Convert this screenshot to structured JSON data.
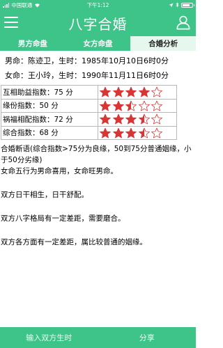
{
  "status_bar": {
    "carrier": "中国联通",
    "time": "下午1:12",
    "battery_level": 0.8
  },
  "navbar": {
    "title": "八字合婚"
  },
  "tabs": [
    {
      "label": "男方命盘",
      "active": false
    },
    {
      "label": "女方命盘",
      "active": false
    },
    {
      "label": "合婚分析",
      "active": true
    }
  ],
  "info": {
    "male": {
      "label": "男命：",
      "name": "陈迹卫，",
      "birth_label": "生时：",
      "birth": "1985年10月10日6时0分"
    },
    "female": {
      "label": "女命：",
      "name": "王小玲，",
      "birth_label": "生时：",
      "birth": "1990年11月11日6时0分"
    }
  },
  "scores": [
    {
      "label": "互相助益指数：75 分",
      "stars": 4
    },
    {
      "label": "缘份指数：50 分",
      "stars": 2.5
    },
    {
      "label": "祸福相配指数：72 分",
      "stars": 3.5
    },
    {
      "label": "综合指数：68 分",
      "stars": 3.5
    }
  ],
  "colors": {
    "accent": "#3ec389",
    "star": "#d93535"
  },
  "judgement": "合婚断语(综合指数>75分为良缘，50到75分普通姻缘，小于50分劣缘)",
  "paragraphs": [
    "女命五行为男命喜用，女命旺男命。",
    "双方日干相生，日干舒配。",
    "双方八字格局有一定差距，需要磨合。",
    "双方各方面有一定差距，属比较普通的姻缘。"
  ],
  "bottom": {
    "input_button": "输入双方生时",
    "share_button": "分享"
  }
}
